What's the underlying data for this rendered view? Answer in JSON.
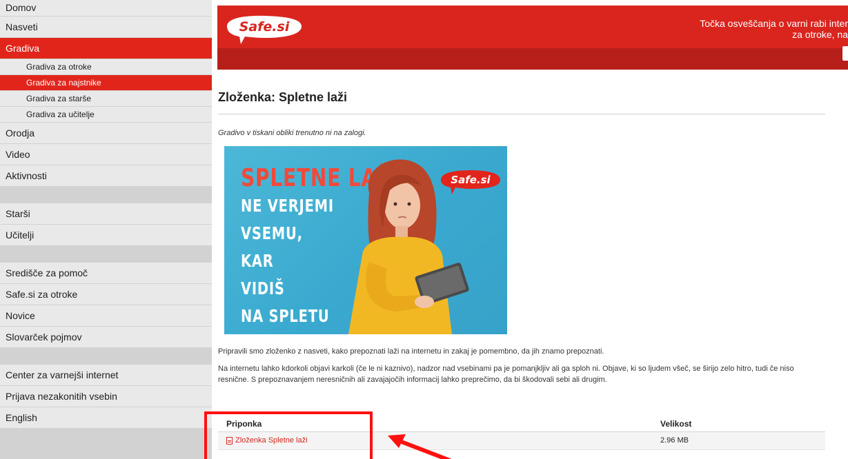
{
  "sidebar": {
    "items": [
      {
        "label": "Domov"
      },
      {
        "label": "Nasveti"
      },
      {
        "label": "Gradiva"
      },
      {
        "label": "Gradiva za otroke"
      },
      {
        "label": "Gradiva za najstnike"
      },
      {
        "label": "Gradiva za starše"
      },
      {
        "label": "Gradiva za učitelje"
      },
      {
        "label": "Orodja"
      },
      {
        "label": "Video"
      },
      {
        "label": "Aktivnosti"
      },
      {
        "label": "Starši"
      },
      {
        "label": "Učitelji"
      },
      {
        "label": "Središče za pomoč"
      },
      {
        "label": "Safe.si za otroke"
      },
      {
        "label": "Novice"
      },
      {
        "label": "Slovarček pojmov"
      },
      {
        "label": "Center za varnejši internet"
      },
      {
        "label": "Prijava nezakonitih vsebin"
      },
      {
        "label": "English"
      }
    ],
    "active_color": "#e1251b"
  },
  "header": {
    "logo_text": "Safe.si",
    "tagline_line1": "Točka osveščanja o varni rabi inter",
    "tagline_line2": "za otroke, na",
    "brand_color": "#d9251d"
  },
  "main": {
    "title": "Zloženka: Spletne laži",
    "stock_note": "Gradivo v tiskani obliki trenutno ni na zalogi.",
    "promo": {
      "headline": "SPLETNE LAŽI",
      "lines": [
        "NE VERJEMI",
        "VSEMU,",
        "KAR",
        "VIDIŠ",
        "NA SPLETU"
      ],
      "logo_text": "Safe.si"
    },
    "para1": "Pripravili smo zloženko z nasveti, kako prepoznati laži na internetu in zakaj je pomembno, da jih znamo prepoznati.",
    "para2": "Na internetu lahko kdorkoli objavi karkoli (če le ni kaznivo), nadzor nad vsebinami pa je pomanjkljiv ali ga sploh ni. Objave, ki so ljudem všeč, se širijo zelo hitro, tudi če niso resnične. S prepoznavanjem neresničnih ali zavajajočih informacij lahko preprečimo, da bi škodovali sebi ali drugim.",
    "attachments": {
      "col_name": "Priponka",
      "col_size": "Velikost",
      "rows": [
        {
          "name": "Zloženka Spletne laži",
          "size": "2.96 MB"
        }
      ]
    }
  }
}
